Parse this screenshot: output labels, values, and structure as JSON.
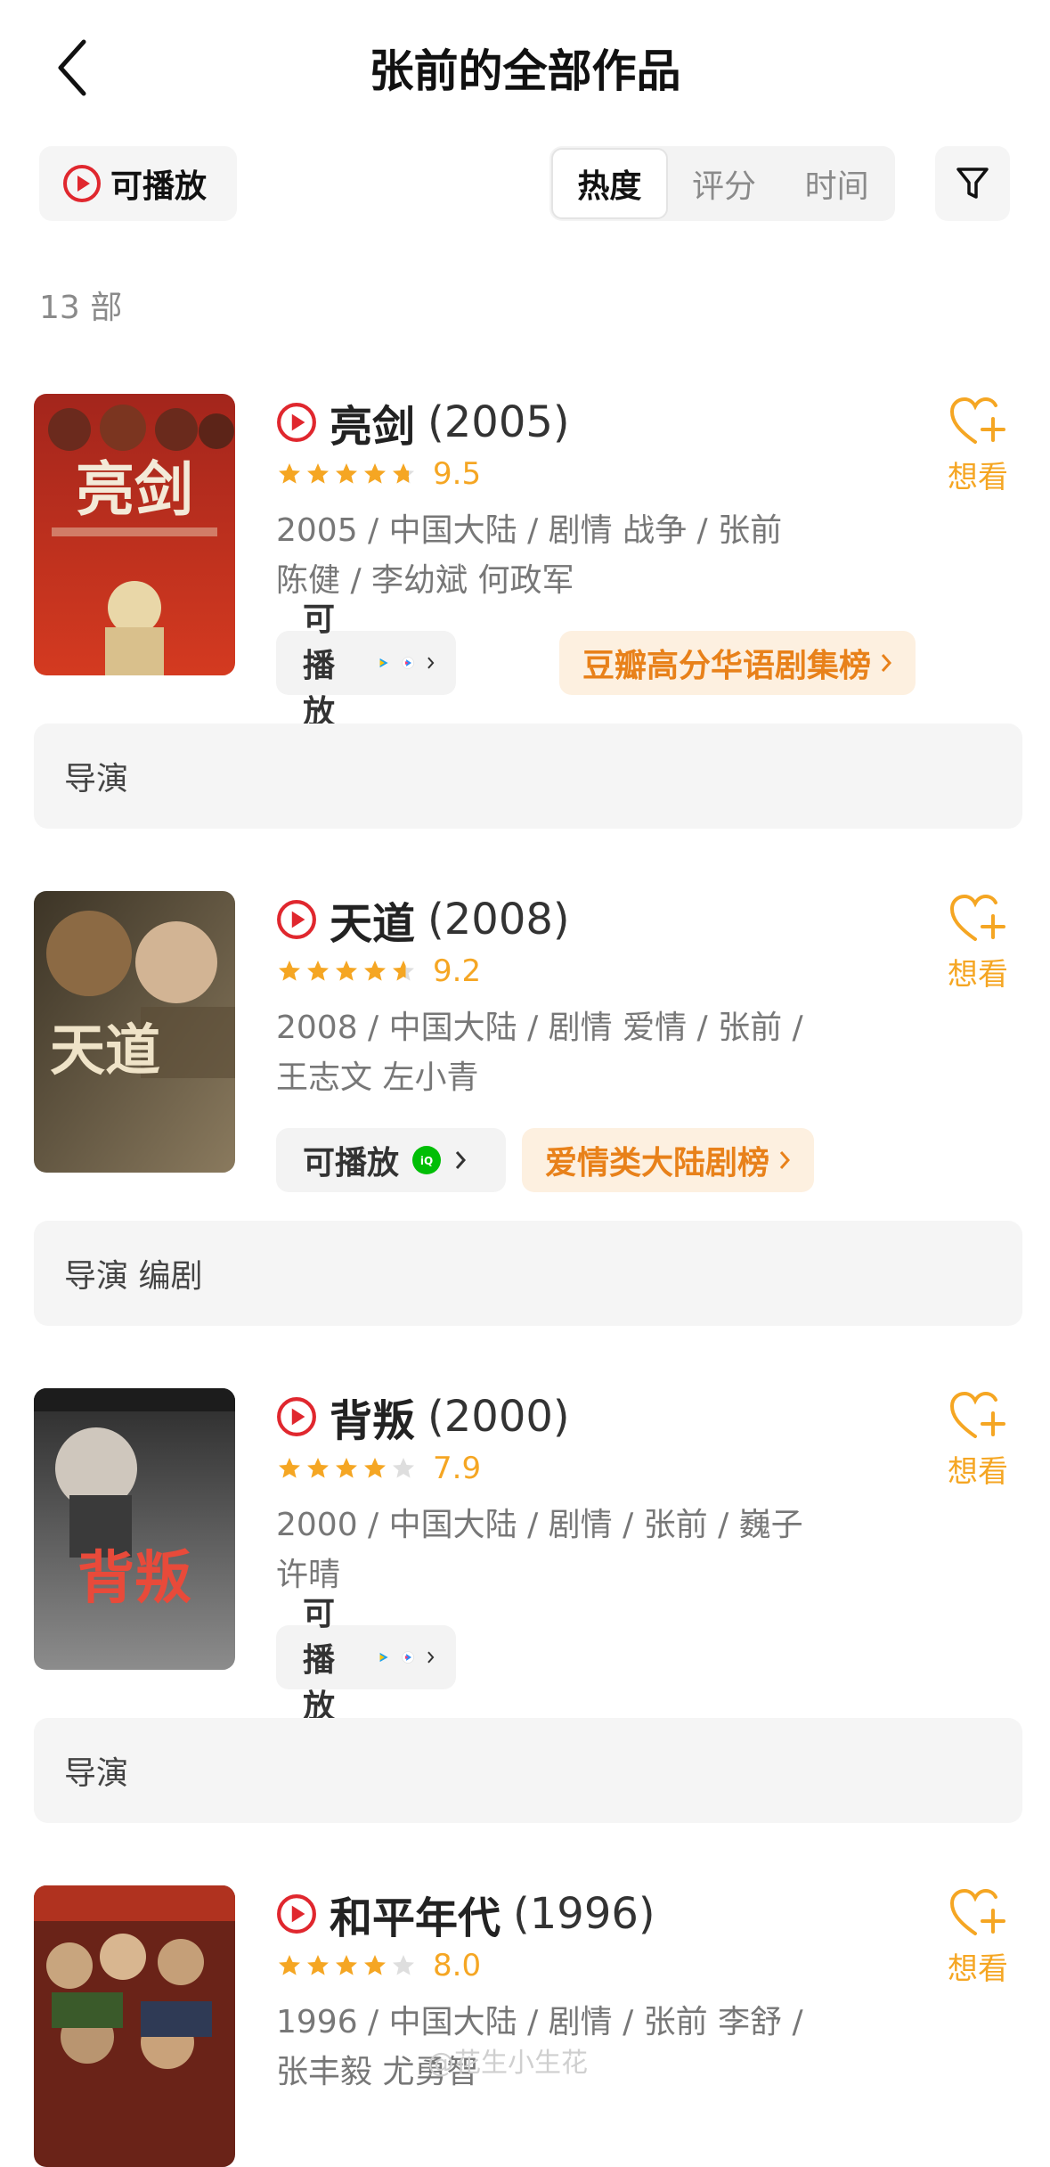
{
  "header": {
    "title": "张前的全部作品"
  },
  "filters": {
    "playable_label": "可播放",
    "sort_options": [
      "热度",
      "评分",
      "时间"
    ],
    "active_sort": "热度"
  },
  "count_text": "13 部",
  "works": [
    {
      "title": "亮剑",
      "year": "(2005)",
      "rating": 4.75,
      "score": "9.5",
      "meta_line1": "2005 / 中国大陆 / 剧情 战争 / 张前",
      "meta_line2": "陈健 / 李幼斌 何政军",
      "play_label": "可播放",
      "platforms": [
        "tencent-video-icon",
        "youku-icon"
      ],
      "rank_label": "豆瓣高分华语剧集榜",
      "want_label": "想看",
      "roles": "导演",
      "poster_text": "亮剑"
    },
    {
      "title": "天道",
      "year": "(2008)",
      "rating": 4.6,
      "score": "9.2",
      "meta_line1": "2008 / 中国大陆 / 剧情 爱情 / 张前 /",
      "meta_line2": "王志文 左小青",
      "play_label": "可播放",
      "platforms": [
        "iqiyi-icon"
      ],
      "rank_label": "爱情类大陆剧榜",
      "want_label": "想看",
      "roles": "导演 编剧",
      "poster_text": "天道"
    },
    {
      "title": "背叛",
      "year": "(2000)",
      "rating": 4.0,
      "score": "7.9",
      "meta_line1": "2000 / 中国大陆 / 剧情 / 张前 / 巍子",
      "meta_line2": "许晴",
      "play_label": "可播放",
      "platforms": [
        "tencent-video-icon",
        "youku-icon"
      ],
      "rank_label": "",
      "want_label": "想看",
      "roles": "导演",
      "poster_text": "背叛"
    },
    {
      "title": "和平年代",
      "year": "(1996)",
      "rating": 4.0,
      "score": "8.0",
      "meta_line1": "1996 / 中国大陆 / 剧情 / 张前 李舒 /",
      "meta_line2": "张丰毅 尤勇智",
      "play_label": "",
      "platforms": [],
      "rank_label": "",
      "want_label": "想看",
      "roles": "",
      "poster_text": ""
    }
  ],
  "watermark": "@花生小生花",
  "colors": {
    "accent": "#f5a623",
    "play_red": "#e0272e",
    "rank_orange": "#e8811a"
  }
}
